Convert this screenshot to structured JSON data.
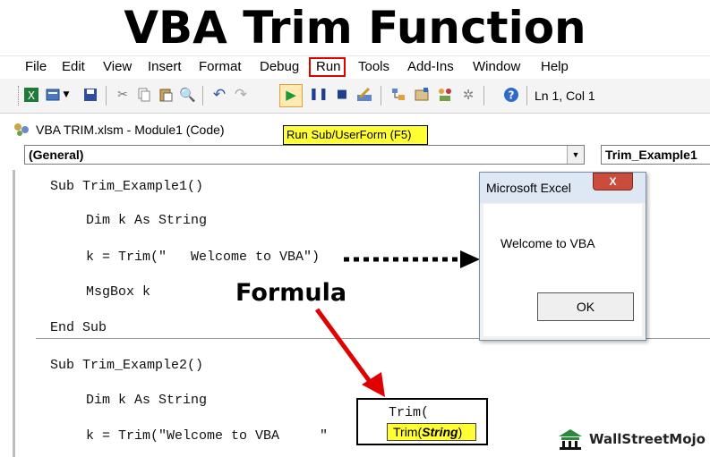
{
  "banner": {
    "title": "VBA Trim Function"
  },
  "menu": {
    "items": [
      {
        "label": "File"
      },
      {
        "label": "Edit"
      },
      {
        "label": "View"
      },
      {
        "label": "Insert"
      },
      {
        "label": "Format"
      },
      {
        "label": "Debug"
      },
      {
        "label": "Run"
      },
      {
        "label": "Tools"
      },
      {
        "label": "Add-Ins"
      },
      {
        "label": "Window"
      },
      {
        "label": "Help"
      }
    ]
  },
  "toolbar": {
    "position": "Ln 1, Col 1"
  },
  "window": {
    "title": "VBA TRIM.xlsm - Module1 (Code)"
  },
  "tooltip": {
    "text": "Run Sub/UserForm (F5)"
  },
  "dropdowns": {
    "object": "(General)",
    "procedure": "Trim_Example1"
  },
  "code": {
    "sub1_decl": "Sub Trim_Example1()",
    "sub1_dim": "Dim k As String",
    "sub1_assign": "k = Trim(\"   Welcome to VBA\")",
    "sub1_msg": "MsgBox k",
    "sub1_end": "End Sub",
    "sub2_decl": "Sub Trim_Example2()",
    "sub2_dim": "Dim k As String",
    "sub2_assign": "k = Trim(\"Welcome to VBA     \""
  },
  "msgbox": {
    "title": "Microsoft Excel",
    "message": "Welcome to VBA",
    "ok": "OK",
    "close": "X"
  },
  "annotation": {
    "formula": "Formula"
  },
  "intellisense": {
    "typed": "Trim(",
    "hint_func": "Trim(",
    "hint_arg": "String",
    "hint_close": ")"
  },
  "logo": {
    "text": "WallStreetMojo"
  },
  "colors": {
    "highlight_red": "#e00000",
    "tooltip_yellow": "#ffff33",
    "keyword_blue": "#00007f"
  }
}
